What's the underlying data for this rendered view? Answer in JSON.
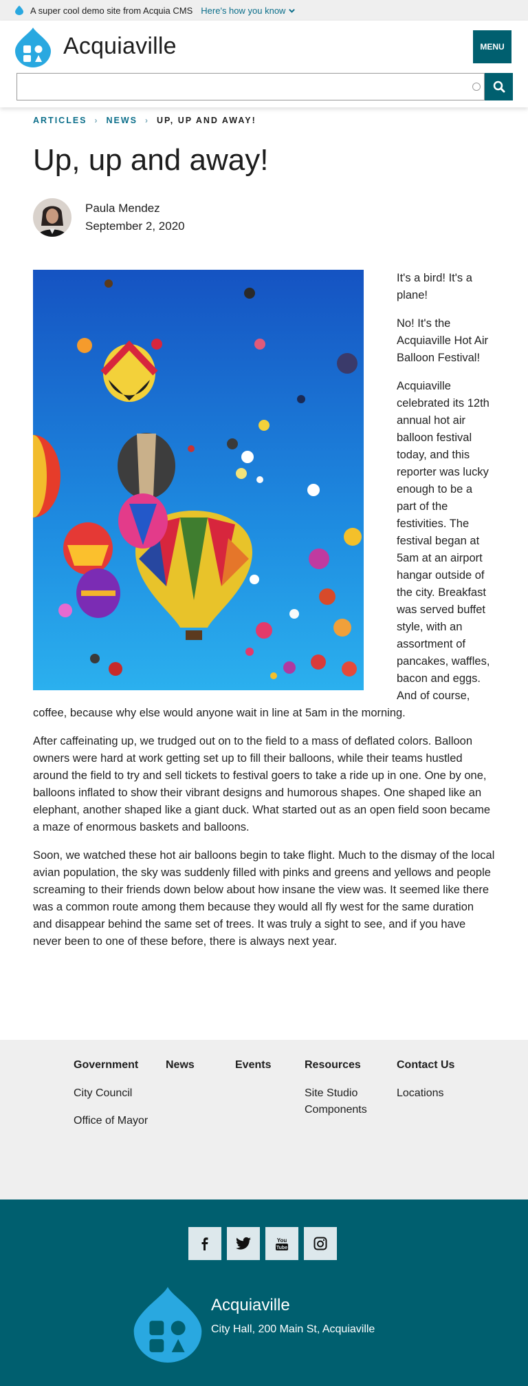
{
  "banner": {
    "text": "A super cool demo site from Acquia CMS",
    "link": "Here's how you know"
  },
  "header": {
    "site_name": "Acquiaville",
    "menu_label": "MENU",
    "search_placeholder": ""
  },
  "breadcrumb": {
    "items": [
      "ARTICLES",
      "NEWS"
    ],
    "current": "UP, UP AND AWAY!"
  },
  "article": {
    "title": "Up, up and away!",
    "author": "Paula Mendez",
    "date": "September 2, 2020",
    "paragraphs": [
      "It's a bird! It's a plane!",
      "No! It's the Acquiaville Hot Air Balloon Festival!",
      "Acquiaville celebrated its 12th annual hot air balloon festival today, and this reporter was lucky enough to be a part of the festivities. The festival began at 5am at an airport hangar outside of the city. Breakfast was served buffet style, with an assortment of pancakes, waffles, bacon and eggs. And of course, coffee, because why else would anyone wait in line at 5am in the morning.",
      "After caffeinating up, we trudged out on to the field to a mass of deflated colors. Balloon owners were hard at work getting set up to fill their balloons, while their teams hustled around the field to try and sell tickets to festival goers to take a ride up in one. One by one, balloons inflated to show their vibrant designs and humorous shapes. One shaped like an elephant, another shaped like a giant duck. What started out as an open field soon became a maze of enormous baskets and balloons.",
      "Soon, we watched these hot air balloons begin to take flight. Much to the dismay of the local avian population, the sky was suddenly filled with pinks and greens and yellows and people screaming to their friends down below about how insane the view was. It seemed like there was a common route among them because they would all fly west for the same duration and disappear behind the same set of trees. It was truly a sight to see, and if you have never been to one of these before, there is always next year."
    ]
  },
  "footer": {
    "columns": [
      {
        "title": "Government",
        "links": [
          "City Council",
          "Office of Mayor"
        ]
      },
      {
        "title": "News",
        "links": []
      },
      {
        "title": "Events",
        "links": []
      },
      {
        "title": "Resources",
        "links": [
          "Site Studio Components"
        ]
      },
      {
        "title": "Contact Us",
        "links": [
          "Locations"
        ]
      }
    ],
    "social": [
      "facebook-icon",
      "twitter-icon",
      "youtube-icon",
      "instagram-icon"
    ],
    "site_name": "Acquiaville",
    "address": "City Hall, 200 Main St, Acquiaville"
  },
  "colors": {
    "brand_teal": "#005f6f",
    "link_teal": "#0b6e8a",
    "logo_blue": "#29a8e0",
    "footer_gray": "#efefef"
  }
}
